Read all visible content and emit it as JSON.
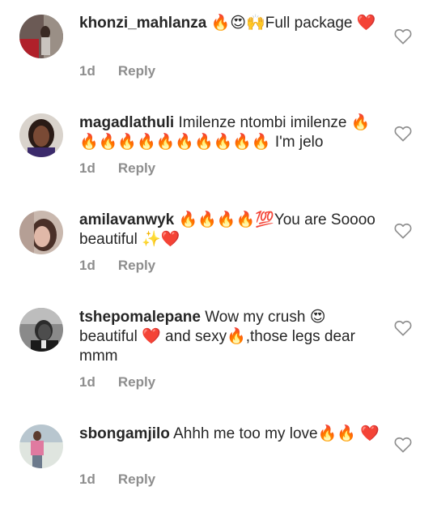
{
  "comments": [
    {
      "username": "khonzi_mahlanza",
      "text": " 🔥😍🙌Full package ❤️",
      "time": "1d",
      "reply_label": "Reply",
      "like_icon": "heart-outline-icon"
    },
    {
      "username": "magadlathuli",
      "text": " Imilenze ntombi imilenze 🔥🔥🔥🔥🔥🔥🔥🔥🔥🔥🔥 I'm jelo",
      "time": "1d",
      "reply_label": "Reply",
      "like_icon": "heart-outline-icon"
    },
    {
      "username": "amilavanwyk",
      "text": " 🔥🔥🔥🔥💯You are Soooo beautiful ✨❤️",
      "time": "1d",
      "reply_label": "Reply",
      "like_icon": "heart-outline-icon"
    },
    {
      "username": "tshepomalepane",
      "text": " Wow my crush 😍 beautiful ❤️ and sexy🔥,those legs dear mmm",
      "time": "1d",
      "reply_label": "Reply",
      "like_icon": "heart-outline-icon"
    },
    {
      "username": "sbongamjilo",
      "text": " Ahhh me too my love🔥🔥 ❤️",
      "time": "1d",
      "reply_label": "Reply",
      "like_icon": "heart-outline-icon"
    }
  ],
  "colors": {
    "text": "#262626",
    "meta": "#8e8e8e",
    "like_outline": "#8e8e8e"
  }
}
